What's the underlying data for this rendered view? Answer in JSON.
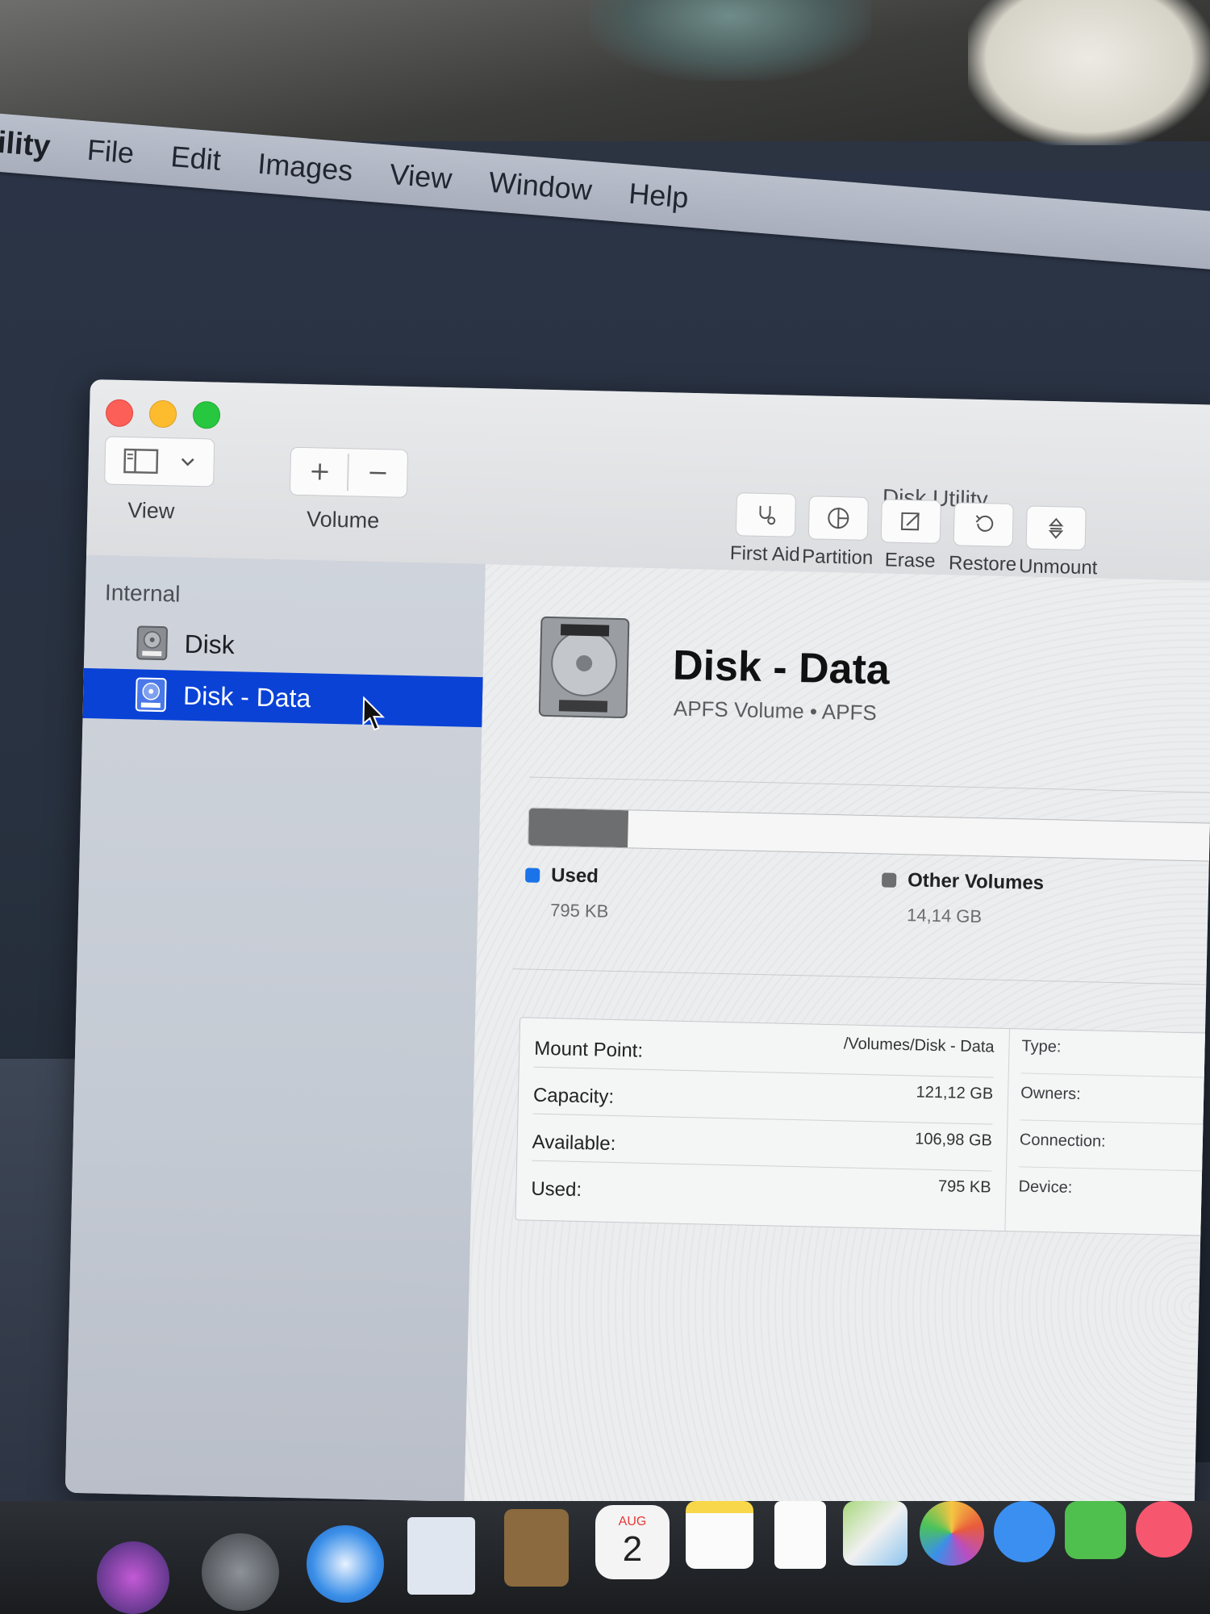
{
  "menubar": {
    "app_name": "ility",
    "items": [
      "File",
      "Edit",
      "Images",
      "View",
      "Window",
      "Help"
    ]
  },
  "window": {
    "title": "Disk Utility",
    "toolbar": {
      "view_label": "View",
      "volume_label": "Volume",
      "tools": [
        {
          "label": "First Aid",
          "icon": "stethoscope-icon"
        },
        {
          "label": "Partition",
          "icon": "pie-icon"
        },
        {
          "label": "Erase",
          "icon": "erase-icon"
        },
        {
          "label": "Restore",
          "icon": "restore-icon"
        },
        {
          "label": "Unmount",
          "icon": "unmount-icon"
        }
      ]
    },
    "sidebar": {
      "heading": "Internal",
      "items": [
        {
          "label": "Disk",
          "selected": false
        },
        {
          "label": "Disk - Data",
          "selected": true
        }
      ]
    },
    "volume": {
      "name": "Disk - Data",
      "subtitle": "APFS Volume • APFS",
      "usage": {
        "used_fraction": 0.145,
        "legend": [
          {
            "label": "Used",
            "value": "795 KB",
            "color": "#1a73e8"
          },
          {
            "label": "Other Volumes",
            "value": "14,14 GB",
            "color": "#6d6e70"
          }
        ]
      },
      "info_left": [
        {
          "key": "Mount Point:",
          "value": "/Volumes/Disk - Data"
        },
        {
          "key": "Capacity:",
          "value": "121,12 GB"
        },
        {
          "key": "Available:",
          "value": "106,98 GB"
        },
        {
          "key": "Used:",
          "value": "795 KB"
        }
      ],
      "info_right": [
        {
          "key": "Type:"
        },
        {
          "key": "Owners:"
        },
        {
          "key": "Connection:"
        },
        {
          "key": "Device:"
        }
      ]
    }
  },
  "dock": {
    "calendar_month": "AUG",
    "calendar_day": "2"
  }
}
